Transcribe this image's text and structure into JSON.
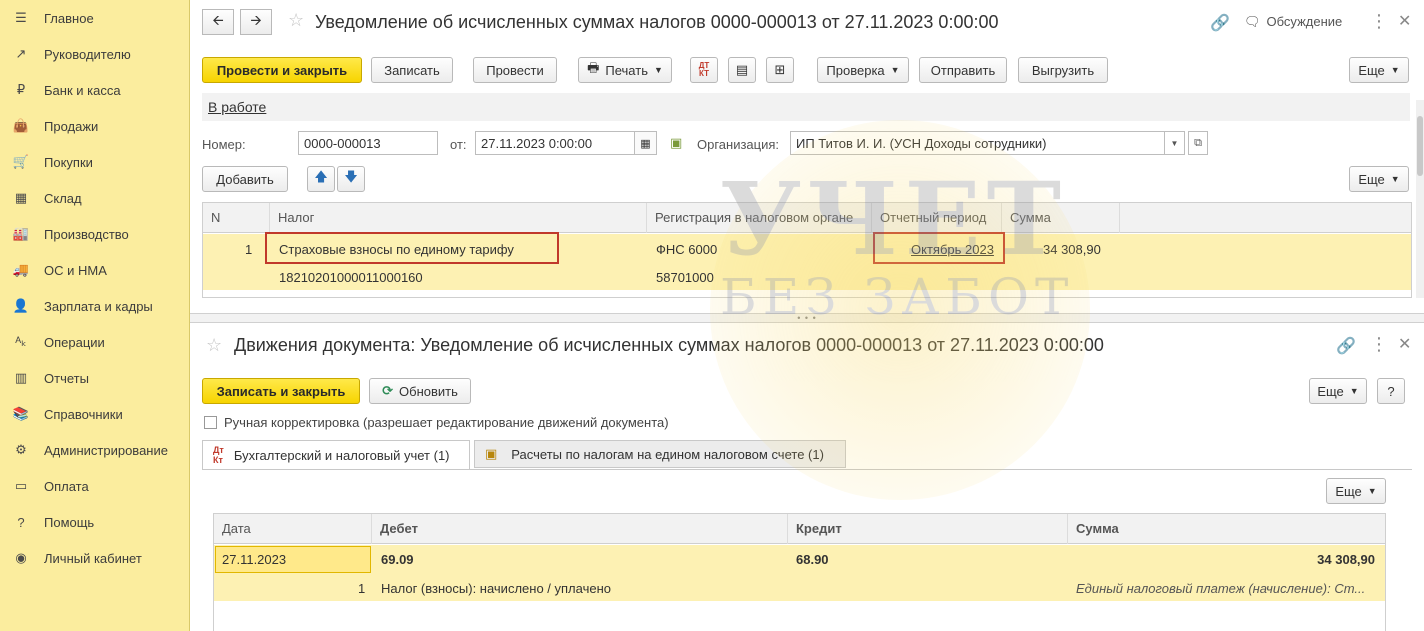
{
  "sidebar": {
    "items": [
      {
        "label": "Главное",
        "icon": "menu-icon"
      },
      {
        "label": "Руководителю",
        "icon": "trend-icon"
      },
      {
        "label": "Банк и касса",
        "icon": "ruble-icon"
      },
      {
        "label": "Продажи",
        "icon": "bag-icon"
      },
      {
        "label": "Покупки",
        "icon": "cart-icon"
      },
      {
        "label": "Склад",
        "icon": "warehouse-icon"
      },
      {
        "label": "Производство",
        "icon": "factory-icon"
      },
      {
        "label": "ОС и НМА",
        "icon": "truck-icon"
      },
      {
        "label": "Зарплата и кадры",
        "icon": "person-icon"
      },
      {
        "label": "Операции",
        "icon": "dt-kt-icon"
      },
      {
        "label": "Отчеты",
        "icon": "bar-chart-icon"
      },
      {
        "label": "Справочники",
        "icon": "books-icon"
      },
      {
        "label": "Администрирование",
        "icon": "gear-icon"
      },
      {
        "label": "Оплата",
        "icon": "card-icon"
      },
      {
        "label": "Помощь",
        "icon": "question-icon"
      },
      {
        "label": "Личный кабинет",
        "icon": "user-circle-icon"
      }
    ]
  },
  "doc": {
    "title": "Уведомление об исчисленных суммах налогов 0000-000013 от 27.11.2023 0:00:00",
    "discussion": "Обсуждение",
    "toolbar": {
      "post_close": "Провести и закрыть",
      "save": "Записать",
      "post": "Провести",
      "print": "Печать",
      "check": "Проверка",
      "send": "Отправить",
      "upload": "Выгрузить",
      "more": "Еще"
    },
    "status_link": "В работе",
    "number_label": "Номер:",
    "number_value": "0000-000013",
    "date_label": "от:",
    "date_value": "27.11.2023  0:00:00",
    "org_label": "Организация:",
    "org_value": "ИП Титов И. И. (УСН Доходы сотрудники)",
    "add_button": "Добавить",
    "more2": "Еще",
    "table": {
      "headers": [
        "N",
        "Налог",
        "Регистрация в налоговом органе",
        "Отчетный период",
        "Сумма"
      ],
      "row": {
        "n": "1",
        "tax": "Страховые взносы по единому тарифу",
        "kbk": "18210201000011000160",
        "registration": "ФНС 6000",
        "oktmo": "58701000",
        "period": "Октябрь 2023",
        "amount": "34 308,90"
      }
    }
  },
  "moves": {
    "title": "Движения документа: Уведомление об исчисленных суммах налогов 0000-000013 от 27.11.2023 0:00:00",
    "save_close": "Записать и закрыть",
    "refresh": "Обновить",
    "more": "Еще",
    "help": "?",
    "manual_label": "Ручная корректировка (разрешает редактирование движений документа)",
    "tabs": [
      "Бухгалтерский и налоговый учет (1)",
      "Расчеты по налогам на едином налоговом счете (1)"
    ],
    "tab_dtkt": "ДТ КТ",
    "more3": "Еще",
    "table": {
      "headers": [
        "Дата",
        "Дебет",
        "Кредит",
        "Сумма"
      ],
      "row": {
        "date": "27.11.2023",
        "debit": "69.09",
        "credit": "68.90",
        "amount": "34 308,90",
        "n": "1",
        "content": "Налог (взносы): начислено / уплачено",
        "comment": "Единый налоговый платеж (начисление): Ст..."
      }
    }
  },
  "watermark": {
    "line1": "УЧЕТ",
    "line2": "БЕЗ ЗАБОТ"
  },
  "colors": {
    "sidebar": "#fbed9e",
    "accent_yellow": "#f7d400",
    "selection": "#fdf1b3",
    "red_box": "#c0392b"
  }
}
